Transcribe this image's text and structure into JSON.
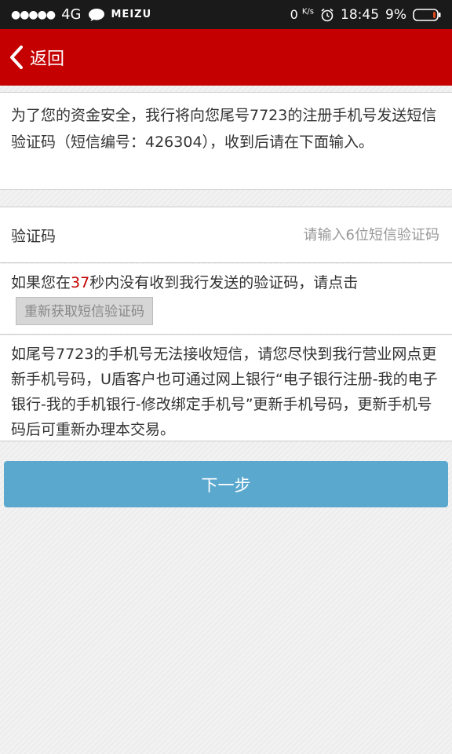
{
  "status_bar": {
    "signal_dots": "●●●●●",
    "network": "4G",
    "carrier": "MEIZU",
    "net_speed": "0",
    "net_speed_unit": "K/s",
    "time": "18:45",
    "battery": "9%",
    "battery_level": 0.09,
    "battery_color": "#e04b1a"
  },
  "header": {
    "back_label": "返回",
    "background": "#c40000"
  },
  "notice": {
    "text": "为了您的资金安全，我行将向您尾号7723的注册手机号发送短信验证码（短信编号：426304），收到后请在下面输入。"
  },
  "verify": {
    "label": "验证码",
    "placeholder": "请输入6位短信验证码",
    "value": ""
  },
  "resend": {
    "prefix": "如果您在",
    "seconds": "37",
    "suffix": "秒内没有收到我行发送的验证码，请点击",
    "button_label": "重新获取短信验证码"
  },
  "info": {
    "text": "如尾号7723的手机号无法接收短信，请您尽快到我行营业网点更新手机号码，U盾客户也可通过网上银行“电子银行注册-我的电子银行-我的手机银行-修改绑定手机号”更新手机号码，更新手机号码后可重新办理本交易。"
  },
  "actions": {
    "next_label": "下一步",
    "next_color": "#5ba8cf"
  }
}
